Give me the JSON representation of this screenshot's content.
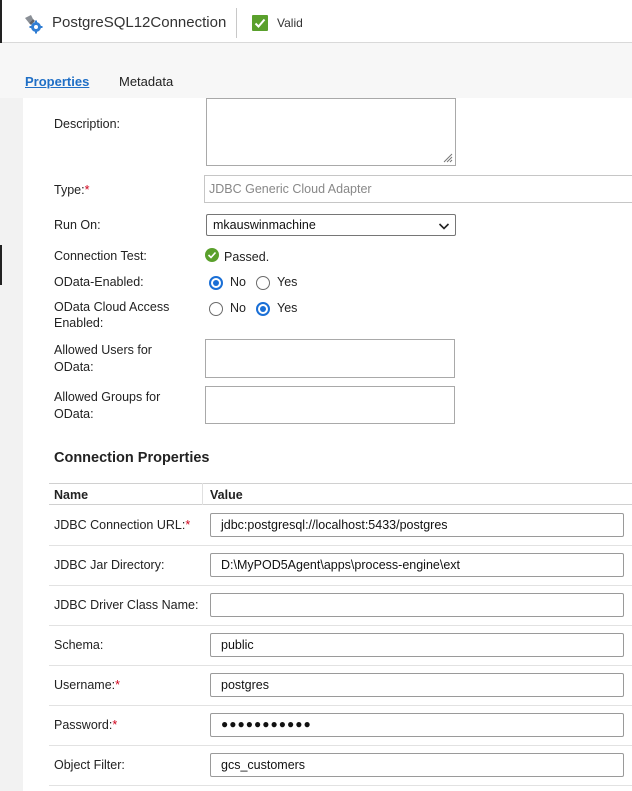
{
  "header": {
    "title": "PostgreSQL12Connection",
    "status": "Valid",
    "icon": "connection-gear-icon",
    "status_color": "#5aa02c"
  },
  "tabs": [
    {
      "label": "Properties",
      "active": true
    },
    {
      "label": "Metadata",
      "active": false
    }
  ],
  "form": {
    "description_label": "Description:",
    "description_value": "",
    "type_label": "Type:",
    "type_value": "JDBC Generic Cloud Adapter",
    "run_on_label": "Run On:",
    "run_on_value": "mkauswinmachine",
    "connection_test_label": "Connection Test:",
    "connection_test_value": "Passed.",
    "odata_enabled_label": "OData-Enabled:",
    "odata_enabled": {
      "no": "No",
      "yes": "Yes",
      "selected": "No"
    },
    "odata_cloud_label_1": "OData Cloud Access",
    "odata_cloud_label_2": "Enabled:",
    "odata_cloud": {
      "no": "No",
      "yes": "Yes",
      "selected": "Yes"
    },
    "allowed_users_label_1": "Allowed Users for",
    "allowed_users_label_2": "OData:",
    "allowed_groups_label_1": "Allowed Groups for",
    "allowed_groups_label_2": "OData:",
    "required_mark": "*"
  },
  "connection_properties": {
    "title": "Connection Properties",
    "col_name": "Name",
    "col_value": "Value",
    "rows": [
      {
        "label": "JDBC Connection URL:",
        "required": "*",
        "value": "jdbc:postgresql://localhost:5433/postgres"
      },
      {
        "label": "JDBC Jar Directory:",
        "required": "",
        "value": "D:\\MyPOD5Agent\\apps\\process-engine\\ext"
      },
      {
        "label": "JDBC Driver Class Name:",
        "required": "",
        "value": ""
      },
      {
        "label": "Schema:",
        "required": "",
        "value": "public"
      },
      {
        "label": "Username:",
        "required": "*",
        "value": "postgres"
      },
      {
        "label": "Password:",
        "required": "*",
        "value": "●●●●●●●●●●●"
      },
      {
        "label": "Object Filter:",
        "required": "",
        "value": "gcs_customers"
      }
    ]
  }
}
